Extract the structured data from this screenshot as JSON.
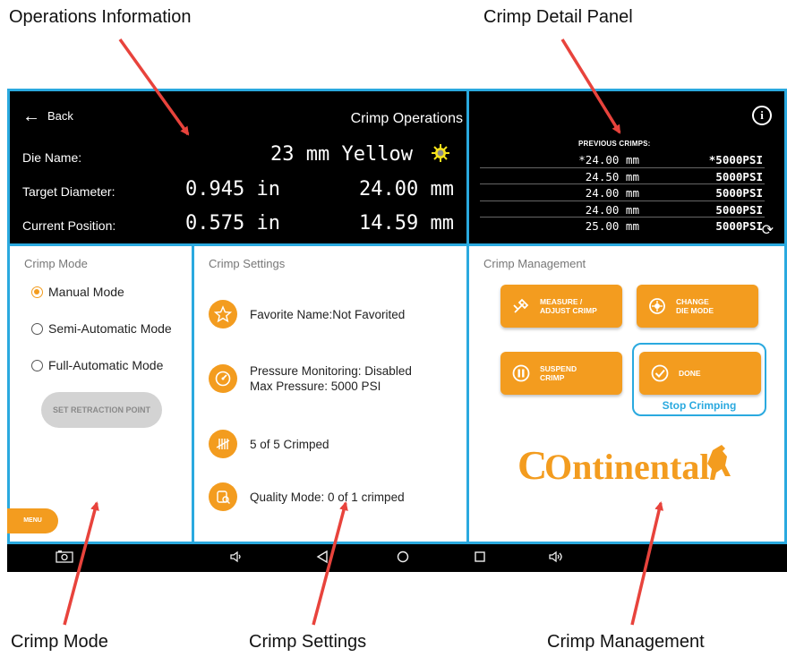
{
  "callouts": {
    "operations": "Operations Information",
    "detail": "Crimp Detail Panel",
    "mode": "Crimp Mode",
    "settings": "Crimp Settings",
    "management": "Crimp Management"
  },
  "operations": {
    "back_label": "Back",
    "title": "Crimp Operations",
    "die_name_label": "Die Name:",
    "die_name_value": "23 mm Yellow",
    "die_color": "#f5e21b",
    "target_label": "Target Diameter:",
    "target_in": "0.945 in",
    "target_mm": "24.00 mm",
    "current_label": "Current Position:",
    "current_in": "0.575 in",
    "current_mm": "14.59 mm"
  },
  "detail": {
    "info_icon": "i",
    "previous_title": "PREVIOUS CRIMPS:",
    "rows": [
      {
        "mm": "*24.00 mm",
        "psi": "*5000PSI"
      },
      {
        "mm": "24.50 mm",
        "psi": "5000PSI"
      },
      {
        "mm": "24.00 mm",
        "psi": "5000PSI"
      },
      {
        "mm": "24.00 mm",
        "psi": "5000PSI"
      },
      {
        "mm": "25.00 mm",
        "psi": "5000PSI"
      }
    ]
  },
  "mode": {
    "title": "Crimp Mode",
    "options": [
      "Manual Mode",
      "Semi-Automatic Mode",
      "Full-Automatic Mode"
    ],
    "selected": "Manual Mode",
    "retraction_button": "SET RETRACTION POINT",
    "menu_button": "MENU"
  },
  "settings": {
    "title": "Crimp Settings",
    "favorite": "Favorite Name:Not Favorited",
    "pressure_line1": "Pressure Monitoring: Disabled",
    "pressure_line2": "Max Pressure: 5000 PSI",
    "crimped": "5 of 5 Crimped",
    "quality": "Quality Mode: 0 of 1 crimped"
  },
  "management": {
    "title": "Crimp Management",
    "measure": "MEASURE /\nADJUST CRIMP",
    "change": "CHANGE\nDIE MODE",
    "suspend": "SUSPEND\nCRIMP",
    "done": "DONE",
    "stop": "Stop Crimping",
    "logo_text": "Ontinental"
  },
  "colors": {
    "accent": "#f39c1f",
    "panel_border": "#2aa9df",
    "arrow": "#e8433c"
  }
}
